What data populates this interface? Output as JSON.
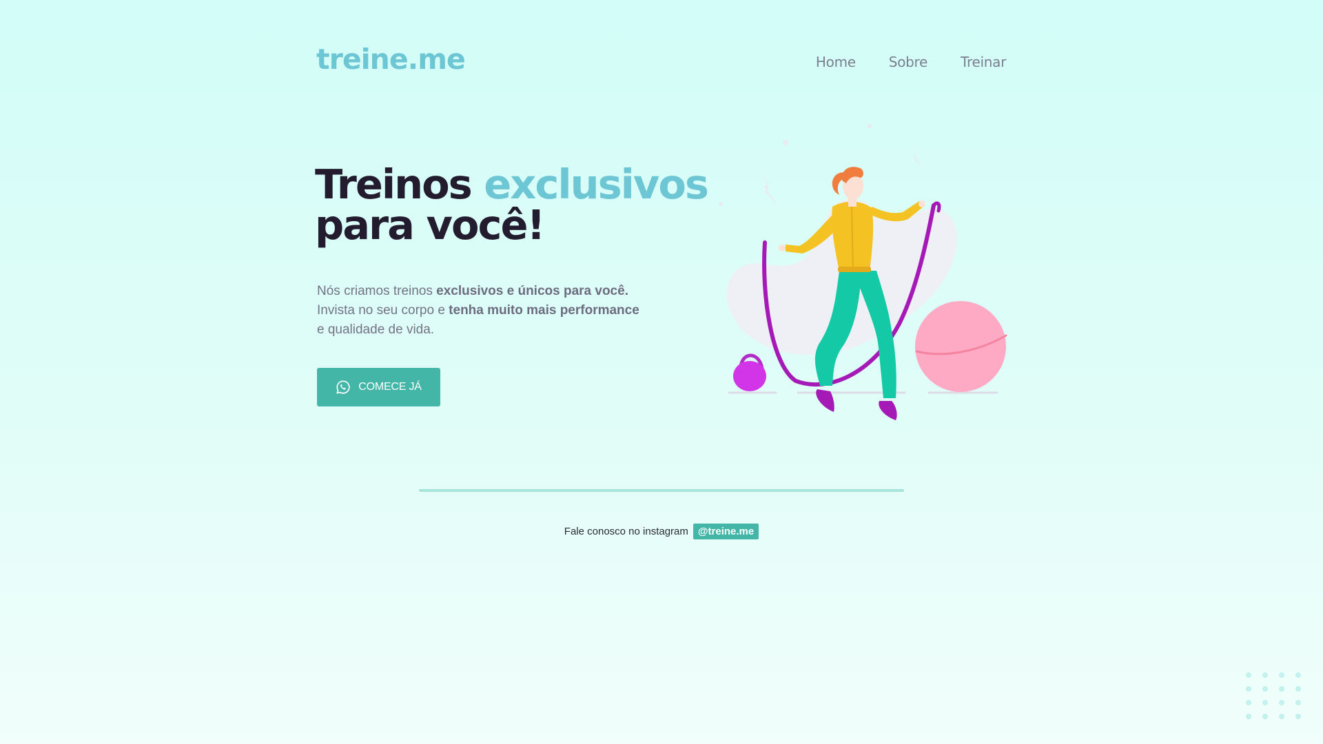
{
  "brand": {
    "logo_text": "treine.me"
  },
  "nav": {
    "items": [
      "Home",
      "Sobre",
      "Treinar"
    ]
  },
  "hero": {
    "title_part1": "Treinos ",
    "title_accent": "exclusivos",
    "title_line2": "para você!",
    "desc": {
      "p1": "Nós criamos treinos ",
      "b1": "exclusivos e únicos para você.",
      "p2": "Invista no seu corpo e ",
      "b2": "tenha muito mais performance",
      "p3": "e qualidade de vida."
    },
    "cta_label": "COMECE JÁ",
    "cta_icon": "whatsapp-icon"
  },
  "illustration": {
    "name": "woman-jumping-rope-illustration"
  },
  "footer": {
    "contact_text": "Fale conosco no instagram",
    "instagram_handle": "@treine.me"
  },
  "colors": {
    "accent": "#6dc6d4",
    "button": "#43b6a8",
    "title": "#231c2e",
    "text": "#737385",
    "divider": "#a4e6d9"
  }
}
